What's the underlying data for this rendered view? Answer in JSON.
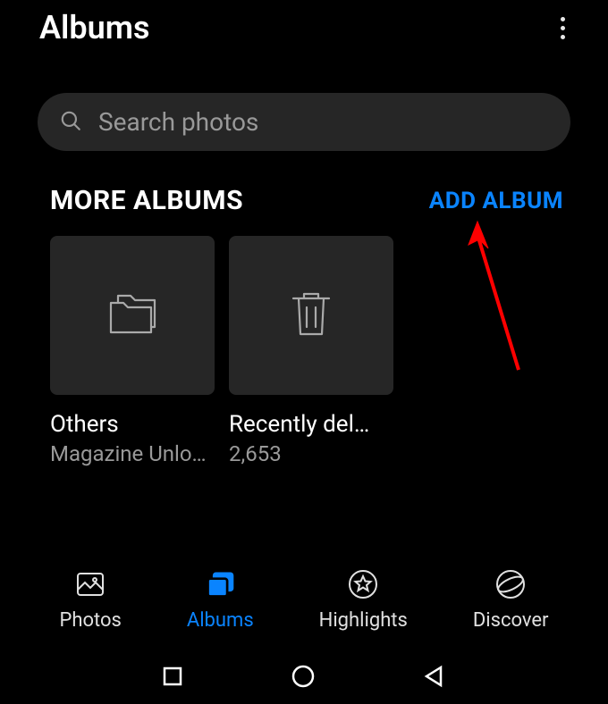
{
  "header": {
    "title": "Albums"
  },
  "search": {
    "placeholder": "Search photos"
  },
  "section": {
    "title": "MORE ALBUMS",
    "add_label": "ADD ALBUM"
  },
  "albums": [
    {
      "name": "Others",
      "subtitle": "Magazine Unlo…",
      "icon": "folder"
    },
    {
      "name": "Recently del…",
      "subtitle": "2,653",
      "icon": "trash"
    }
  ],
  "bottom_nav": {
    "photos": "Photos",
    "albums": "Albums",
    "highlights": "Highlights",
    "discover": "Discover"
  },
  "colors": {
    "accent": "#0a84ff",
    "annotation": "#ff0000"
  }
}
